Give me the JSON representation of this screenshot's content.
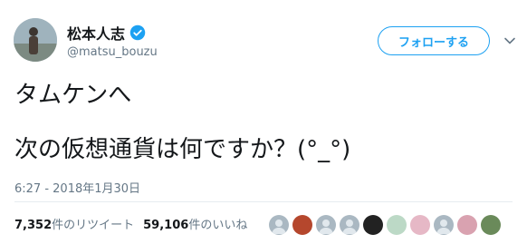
{
  "user": {
    "name": "松本人志",
    "handle": "@matsu_bouzu"
  },
  "follow_button": {
    "label": "フォローする"
  },
  "tweet": {
    "line1": "タムケンへ",
    "line2": "次の仮想通貨は何ですか？(°_°)"
  },
  "timestamp": "6:27 - 2018年1月30日",
  "stats": {
    "retweets_count": "7,352",
    "retweets_label": "件のリツイート",
    "likes_count": "59,106",
    "likes_label": "件のいいね"
  },
  "colors": {
    "accent": "#1da1f2",
    "secondary_text": "#657786",
    "divider": "#e6ecf0"
  },
  "liker_avatars": [
    {
      "icon": "default-avatar-icon",
      "color": "#aab8c2"
    },
    {
      "icon": "user-avatar-icon",
      "color": "#b5472d"
    },
    {
      "icon": "default-avatar-icon",
      "color": "#aab8c2"
    },
    {
      "icon": "default-avatar-icon",
      "color": "#aab8c2"
    },
    {
      "icon": "user-avatar-icon",
      "color": "#222222"
    },
    {
      "icon": "user-avatar-icon",
      "color": "#bcd9c6"
    },
    {
      "icon": "user-avatar-icon",
      "color": "#e6b8c6"
    },
    {
      "icon": "default-avatar-icon",
      "color": "#aab8c2"
    },
    {
      "icon": "user-avatar-icon",
      "color": "#d9a2b0"
    },
    {
      "icon": "user-avatar-icon",
      "color": "#6a8a5a"
    }
  ]
}
